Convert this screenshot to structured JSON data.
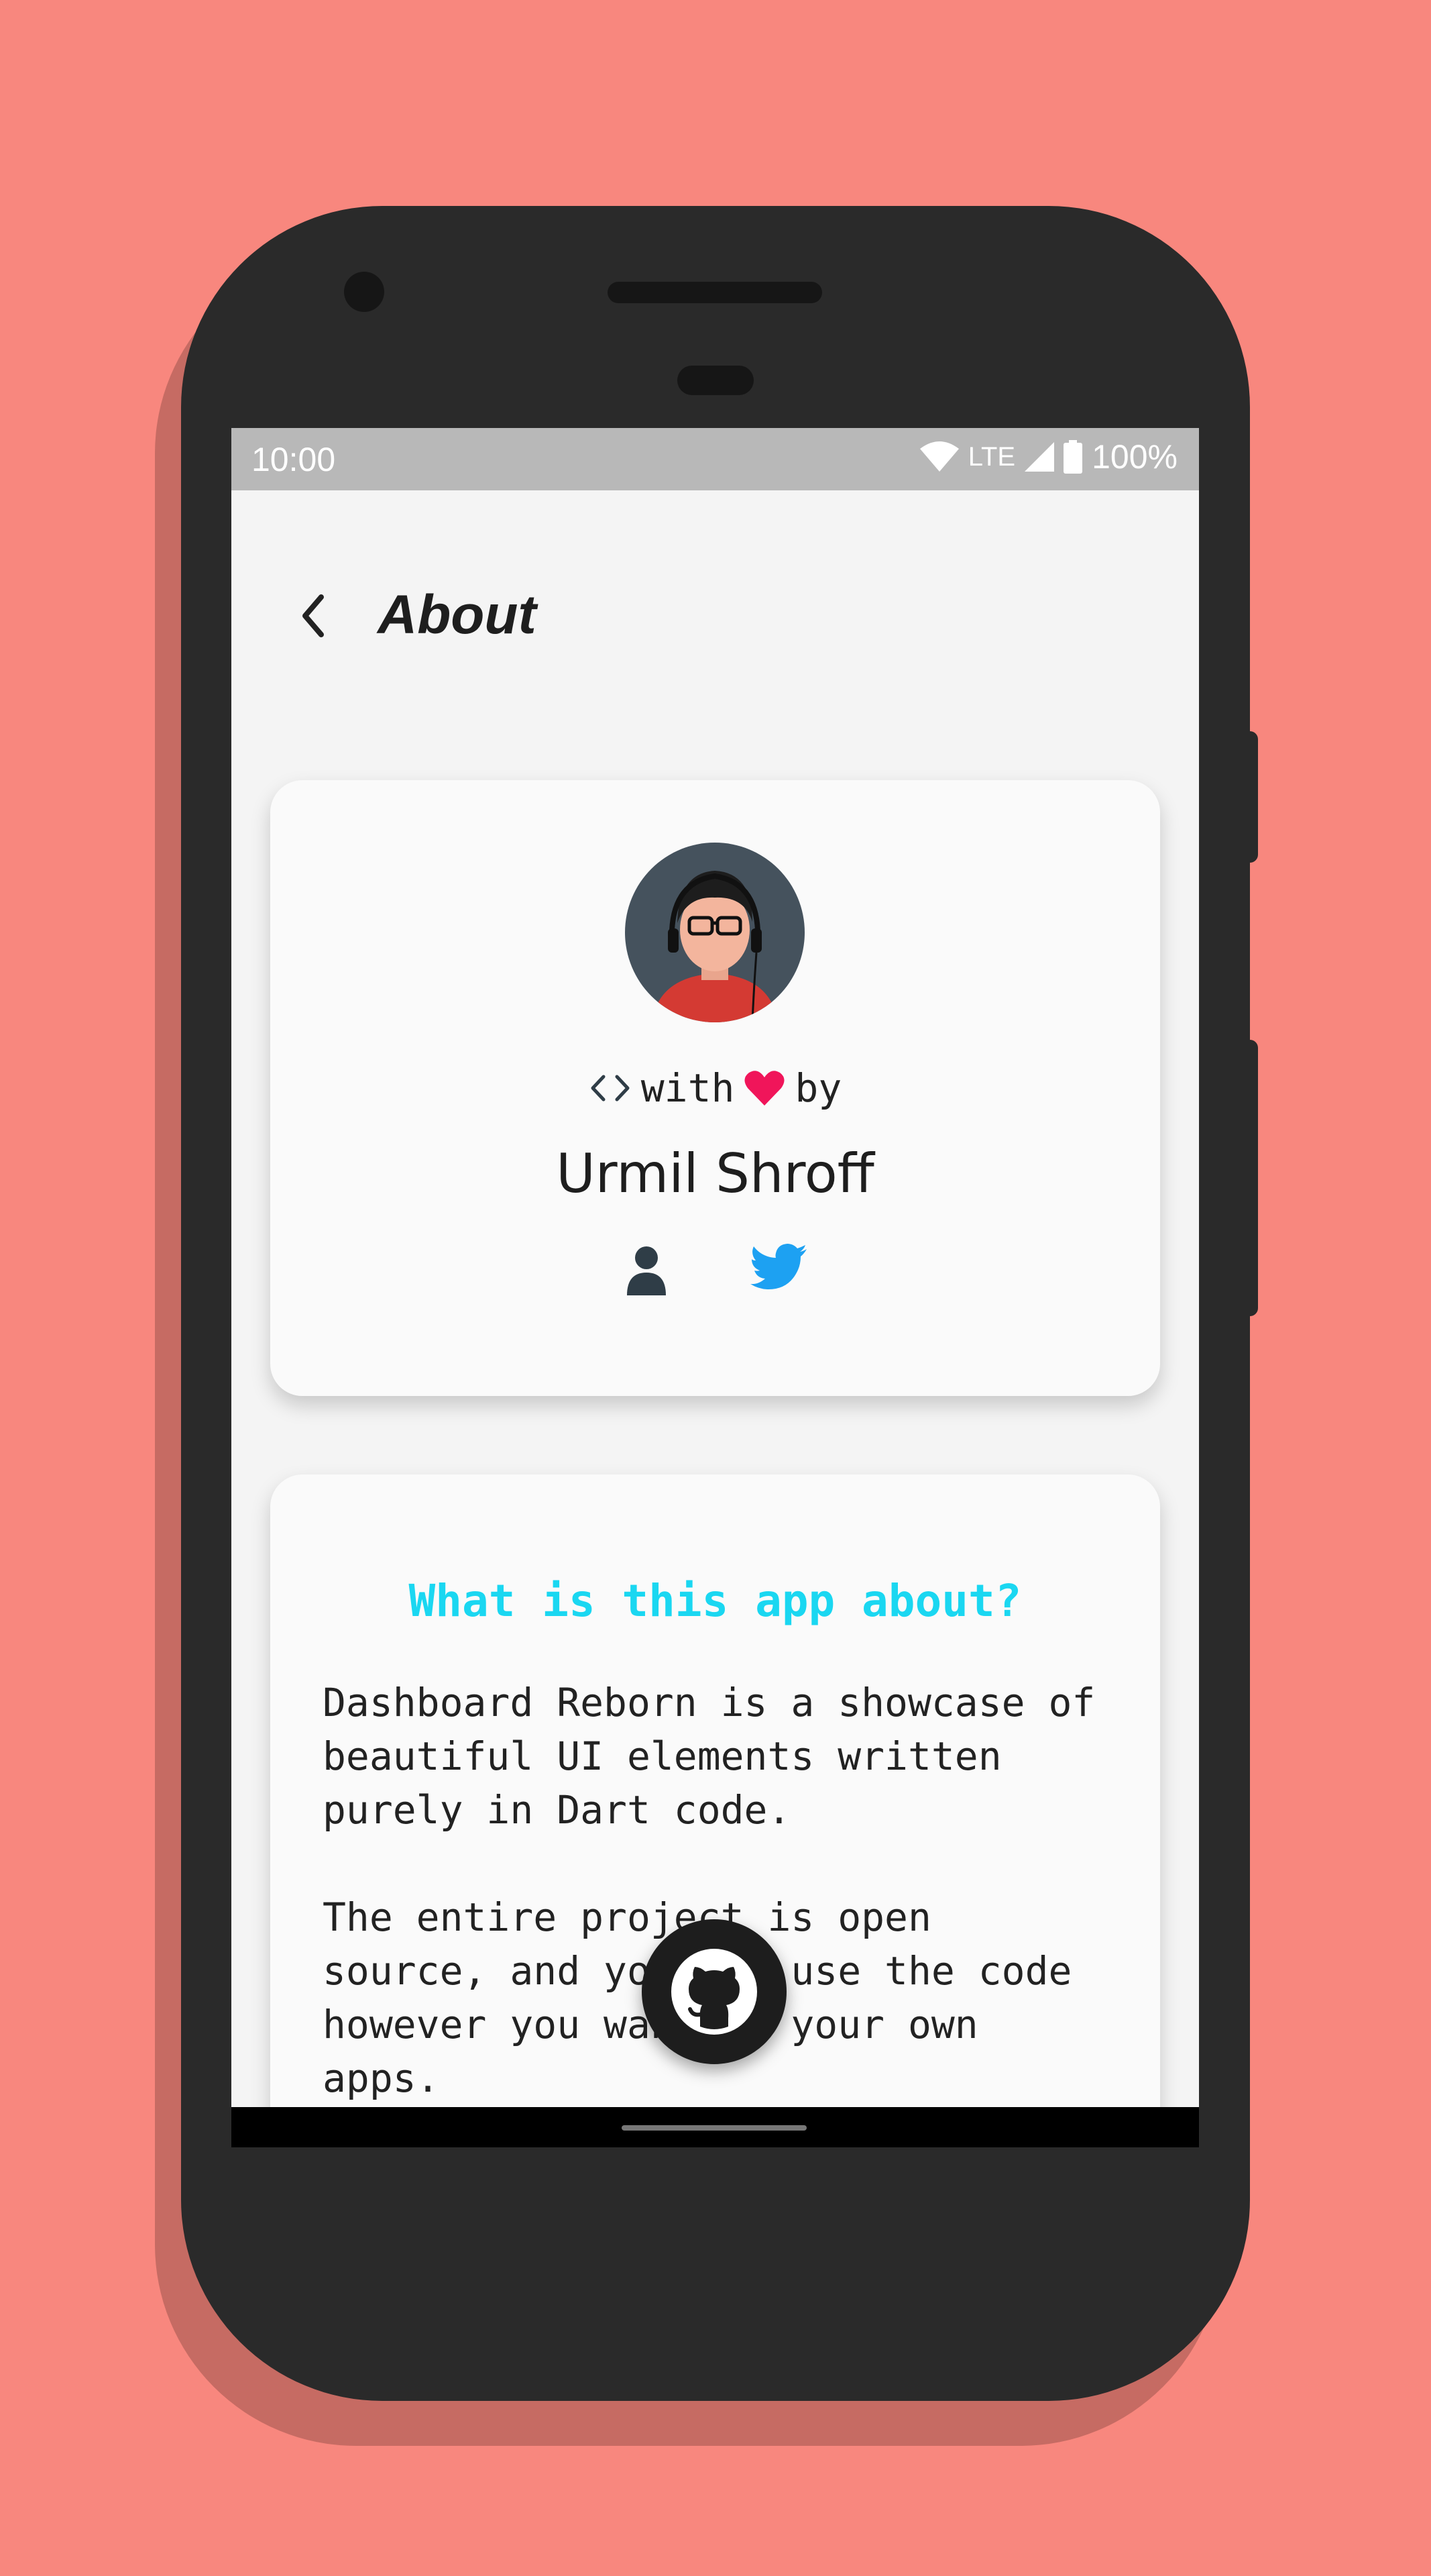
{
  "status_bar": {
    "time": "10:00",
    "network": "LTE",
    "battery": "100%",
    "icons": [
      "wifi-icon",
      "cell-signal-icon",
      "battery-icon"
    ]
  },
  "app_bar": {
    "title": "About",
    "back_icon": "chevron-left-icon"
  },
  "profile_card": {
    "avatar": "developer-avatar",
    "made_with": {
      "code_icon": "code-brackets-icon",
      "word_with": "with",
      "heart_icon": "heart-icon",
      "word_by": "by"
    },
    "author_name": "Urmil Shroff",
    "links": [
      {
        "icon": "person-icon",
        "color": "#2f3d47"
      },
      {
        "icon": "twitter-icon",
        "color": "#1da1f2"
      }
    ]
  },
  "about_card": {
    "heading": "What is this app about?",
    "paragraph_1": "Dashboard Reborn is a showcase of beautiful UI elements written purely in Dart code.",
    "paragraph_2": "The entire project is open source, and you can use the code however you want in your own apps."
  },
  "fab": {
    "icon": "github-icon"
  },
  "colors": {
    "background": "#f8877e",
    "heading_accent": "#1ad7f1",
    "heart": "#f0155a",
    "twitter": "#1da1f2"
  }
}
